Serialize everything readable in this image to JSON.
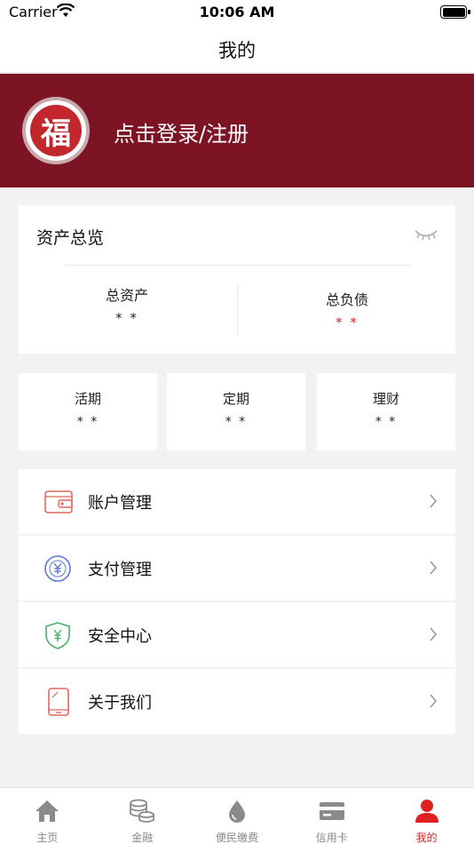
{
  "status_bar": {
    "carrier": "Carrier",
    "time": "10:06 AM"
  },
  "nav": {
    "title": "我的"
  },
  "banner": {
    "avatar_char": "福",
    "login_text": "点击登录/注册"
  },
  "assets": {
    "title": "资产总览",
    "total_assets_label": "总资产",
    "total_assets_value": "* *",
    "total_liabilities_label": "总负债",
    "total_liabilities_value": "* *"
  },
  "accounts": [
    {
      "label": "活期",
      "value": "* *"
    },
    {
      "label": "定期",
      "value": "* *"
    },
    {
      "label": "理财",
      "value": "* *"
    }
  ],
  "menu": [
    {
      "label": "账户管理",
      "icon": "wallet-icon"
    },
    {
      "label": "支付管理",
      "icon": "yuan-circle-icon"
    },
    {
      "label": "安全中心",
      "icon": "shield-yuan-icon"
    },
    {
      "label": "关于我们",
      "icon": "tablet-icon"
    }
  ],
  "tabs": [
    {
      "label": "主页",
      "icon": "home-icon"
    },
    {
      "label": "金融",
      "icon": "coins-icon"
    },
    {
      "label": "便民缴费",
      "icon": "drop-icon"
    },
    {
      "label": "信用卡",
      "icon": "card-icon"
    },
    {
      "label": "我的",
      "icon": "person-icon",
      "active": true
    }
  ],
  "colors": {
    "brand": "#7c1424",
    "accent": "#e02020"
  }
}
